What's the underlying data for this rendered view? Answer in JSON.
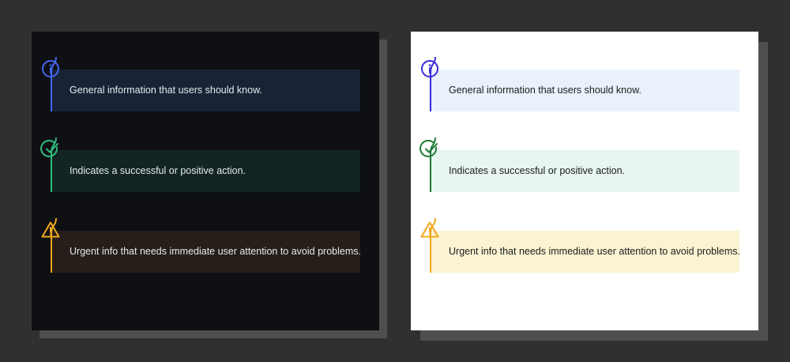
{
  "colors": {
    "background": "#303030",
    "shadow": "#4f4f4f",
    "dark_panel": "#0e1014",
    "light_panel": "#ffffff"
  },
  "panels": [
    {
      "theme": "dark",
      "callouts": [
        {
          "kind": "info",
          "icon": "info-icon",
          "text": "General information that users should know.",
          "accent": "#4468f2",
          "bg": "#182436",
          "text_color": "#e6e9ee"
        },
        {
          "kind": "success",
          "icon": "check-circle-icon",
          "text": "Indicates a successful or positive action.",
          "accent": "#2fbd7c",
          "bg": "#122522",
          "text_color": "#e6e9ee"
        },
        {
          "kind": "warning",
          "icon": "warning-triangle-icon",
          "text": "Urgent info that needs immediate user attention to avoid problems.",
          "accent": "#f0a81c",
          "bg": "#261e19",
          "text_color": "#e6e9ee"
        }
      ]
    },
    {
      "theme": "light",
      "callouts": [
        {
          "kind": "info",
          "icon": "info-icon",
          "text": "General information that users should know.",
          "accent": "#3a2ad6",
          "bg": "#e8f1fc",
          "text_color": "#1c1c1c"
        },
        {
          "kind": "success",
          "icon": "check-circle-icon",
          "text": "Indicates a successful or positive action.",
          "accent": "#1d7a3a",
          "bg": "#e8f6f0",
          "text_color": "#1c1c1c"
        },
        {
          "kind": "warning",
          "icon": "warning-triangle-icon",
          "text": "Urgent info that needs immediate user attention to avoid problems.",
          "accent": "#f0a81c",
          "bg": "#fbf3d2",
          "text_color": "#1c1c1c"
        }
      ]
    }
  ]
}
